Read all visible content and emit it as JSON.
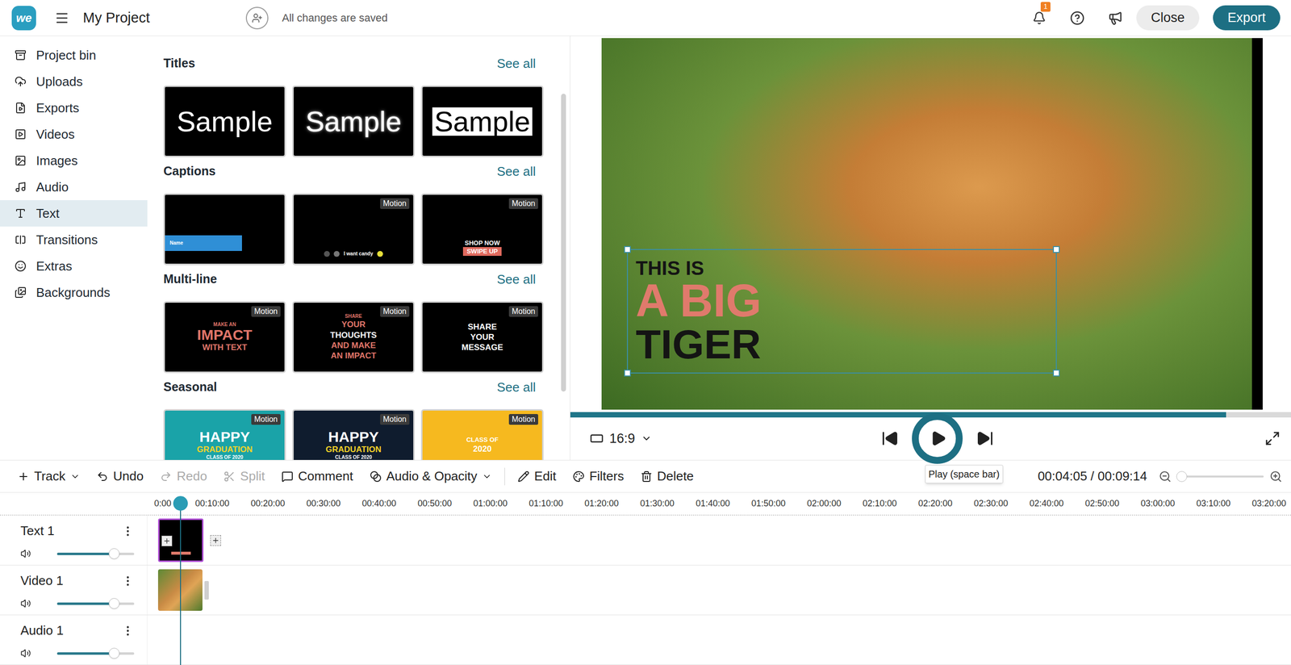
{
  "app": {
    "logo": "we",
    "project_title": "My Project",
    "save_status": "All changes are saved",
    "notification_count": "1",
    "buttons": [
      {
        "label": "Close",
        "primary": false
      },
      {
        "label": "Export",
        "primary": true
      }
    ]
  },
  "sidebar": {
    "items": [
      {
        "label": "Project bin",
        "selected": false
      },
      {
        "label": "Uploads",
        "selected": false
      },
      {
        "label": "Exports",
        "selected": false
      },
      {
        "label": "Videos",
        "selected": false
      },
      {
        "label": "Images",
        "selected": false
      },
      {
        "label": "Audio",
        "selected": false
      },
      {
        "label": "Text",
        "selected": true
      },
      {
        "label": "Transitions",
        "selected": false
      },
      {
        "label": "Extras",
        "selected": false
      },
      {
        "label": "Backgrounds",
        "selected": false
      }
    ]
  },
  "library": {
    "sections": [
      {
        "title": "Titles",
        "see_all": "See all",
        "cards": [
          {
            "kind": "plain",
            "color": "#000000",
            "badge": "",
            "lines": [
              {
                "text": "Sample",
                "size": "xl",
                "color": "#ffffff",
                "background": ""
              }
            ]
          },
          {
            "kind": "outline",
            "color": "#000000",
            "badge": "",
            "lines": [
              {
                "text": "Sample",
                "size": "xl",
                "color": "#ffffff",
                "background": ""
              }
            ]
          },
          {
            "kind": "boxed",
            "color": "#000000",
            "badge": "",
            "lines": [
              {
                "text": "Sample",
                "size": "xl",
                "color": "#000000",
                "background": "#ffffff"
              }
            ]
          }
        ]
      },
      {
        "title": "Captions",
        "see_all": "See all",
        "cards": [
          {
            "kind": "bar",
            "color": "#000000",
            "badge": "",
            "lines": [
              {
                "text": "Name",
                "size": "xs",
                "color": "#ffffff",
                "background": ""
              }
            ]
          },
          {
            "kind": "dots",
            "color": "#000000",
            "badge": "Motion",
            "lines": [
              {
                "text": "I want candy",
                "size": "xs",
                "color": "#ffffff",
                "background": ""
              }
            ]
          },
          {
            "kind": "shop",
            "color": "#000000",
            "badge": "Motion",
            "lines": [
              {
                "text": "SHOP NOW",
                "size": "s",
                "color": "#ffffff",
                "background": ""
              },
              {
                "text": "SWIPE UP",
                "size": "s",
                "color": "#ffffff",
                "background": "#e06a5e"
              }
            ]
          }
        ]
      },
      {
        "title": "Multi-line",
        "see_all": "See all",
        "cards": [
          {
            "kind": "stack",
            "color": "#000000",
            "badge": "Motion",
            "lines": [
              {
                "text": "MAKE AN",
                "size": "xs",
                "color": "#e0766a",
                "background": ""
              },
              {
                "text": "IMPACT",
                "size": "l",
                "color": "#e0766a",
                "background": ""
              },
              {
                "text": "WITH TEXT",
                "size": "m",
                "color": "#e0766a",
                "background": ""
              }
            ]
          },
          {
            "kind": "stack",
            "color": "#000000",
            "badge": "Motion",
            "lines": [
              {
                "text": "SHARE",
                "size": "xs",
                "color": "#e0766a",
                "background": ""
              },
              {
                "text": "YOUR",
                "size": "m",
                "color": "#e0766a",
                "background": ""
              },
              {
                "text": "THOUGHTS",
                "size": "m",
                "color": "#ffffff",
                "background": ""
              },
              {
                "text": "AND MAKE",
                "size": "m",
                "color": "#e0766a",
                "background": ""
              },
              {
                "text": "AN IMPACT",
                "size": "m",
                "color": "#e0766a",
                "background": ""
              }
            ]
          },
          {
            "kind": "stack",
            "color": "#000000",
            "badge": "Motion",
            "lines": [
              {
                "text": "SHARE",
                "size": "m",
                "color": "#ffffff",
                "background": ""
              },
              {
                "text": "YOUR",
                "size": "m",
                "color": "#ffffff",
                "background": ""
              },
              {
                "text": "MESSAGE",
                "size": "m",
                "color": "#ffffff",
                "background": ""
              }
            ]
          }
        ]
      },
      {
        "title": "Seasonal",
        "see_all": "See all",
        "cards": [
          {
            "kind": "stack",
            "color": "#1aa3a8",
            "badge": "Motion",
            "lines": [
              {
                "text": "HAPPY",
                "size": "l",
                "color": "#ffffff",
                "background": ""
              },
              {
                "text": "GRADUATION",
                "size": "m",
                "color": "#f5d327",
                "background": ""
              },
              {
                "text": "CLASS OF 2020",
                "size": "xs",
                "color": "#ffffff",
                "background": ""
              }
            ]
          },
          {
            "kind": "stack",
            "color": "#0f1c2e",
            "badge": "Motion",
            "lines": [
              {
                "text": "HAPPY",
                "size": "l",
                "color": "#ffffff",
                "background": ""
              },
              {
                "text": "GRADUATION",
                "size": "m",
                "color": "#f5d327",
                "background": ""
              },
              {
                "text": "CLASS OF 2020",
                "size": "xs",
                "color": "#ffffff",
                "background": ""
              }
            ]
          },
          {
            "kind": "stack",
            "color": "#f6b91f",
            "badge": "Motion",
            "lines": [
              {
                "text": "CLASS OF",
                "size": "s",
                "color": "#ffffff",
                "background": ""
              },
              {
                "text": "2020",
                "size": "m",
                "color": "#ffffff",
                "background": ""
              }
            ]
          }
        ]
      }
    ]
  },
  "preview": {
    "overlay_lines": [
      {
        "text": "THIS IS",
        "kind": "small",
        "color": "#141414"
      },
      {
        "text": "A BIG",
        "kind": "heavy",
        "color": "#e07a6c"
      },
      {
        "text": "TIGER",
        "kind": "large",
        "color": "#141414"
      }
    ],
    "progress": {
      "level": 0.91
    },
    "aspect": "16:9",
    "tooltip": "Play (space bar)"
  },
  "toolbar": {
    "left_items": [
      {
        "label": "Track",
        "disabled": false,
        "dropdown": true
      },
      {
        "label": "Undo",
        "disabled": false,
        "dropdown": false
      },
      {
        "label": "Redo",
        "disabled": true,
        "dropdown": false
      },
      {
        "label": "Split",
        "disabled": true,
        "dropdown": false
      },
      {
        "label": "Comment",
        "disabled": false,
        "dropdown": false
      },
      {
        "label": "Audio & Opacity",
        "disabled": false,
        "dropdown": true
      }
    ],
    "clip_items": [
      {
        "label": "Edit",
        "disabled": false
      },
      {
        "label": "Filters",
        "disabled": false
      },
      {
        "label": "Delete",
        "disabled": false
      }
    ],
    "time": "00:04:05 / 00:09:14",
    "zoom": {
      "level": 0.05
    }
  },
  "timeline": {
    "ruler": [
      "0:00",
      "00:10:00",
      "00:20:00",
      "00:30:00",
      "00:40:00",
      "00:50:00",
      "01:00:00",
      "01:10:00",
      "01:20:00",
      "01:30:00",
      "01:40:00",
      "01:50:00",
      "02:00:00",
      "02:10:00",
      "02:20:00",
      "02:30:00",
      "02:40:00",
      "02:50:00",
      "03:00:00",
      "03:10:00",
      "03:20:00"
    ],
    "tracks": [
      {
        "name": "Text 1",
        "kind": "text",
        "level": 0.74,
        "selected": true
      },
      {
        "name": "Video 1",
        "kind": "video",
        "level": 0.74,
        "selected": false
      },
      {
        "name": "Audio 1",
        "kind": "audio",
        "level": 0.74,
        "selected": false
      }
    ]
  }
}
